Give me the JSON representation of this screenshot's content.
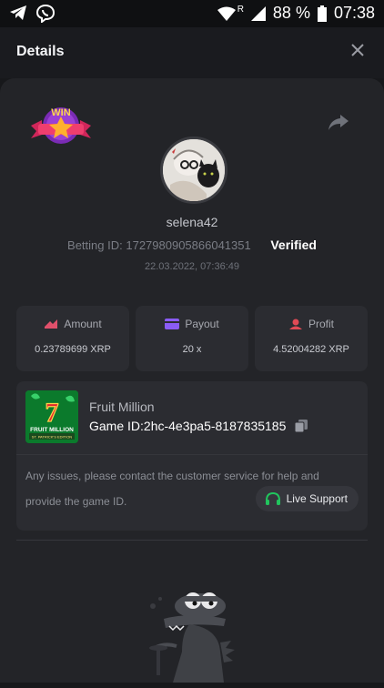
{
  "status_bar": {
    "battery": "88 %",
    "signal_letter": "R",
    "time": "07:38"
  },
  "header": {
    "title": "Details"
  },
  "win_badge": {
    "text": "WIN"
  },
  "user": {
    "name": "selena42",
    "betting_id_label": "Betting ID:",
    "betting_id": "1727980905866041351",
    "verified": "Verified",
    "datetime": "22.03.2022, 07:36:49"
  },
  "stats": [
    {
      "label": "Amount",
      "value": "0.23789699 XRP",
      "color": "#e0506b"
    },
    {
      "label": "Payout",
      "value": "20 x",
      "color": "#8a5cf6"
    },
    {
      "label": "Profit",
      "value": "4.52004282 XRP",
      "color": "#e04a55"
    }
  ],
  "game": {
    "name": "Fruit Million",
    "id_label": "Game ID:",
    "id": "2hc-4e3pa5-8187835185",
    "thumb_title": "FRUIT MILLION",
    "thumb_subtitle": "ST. PATRICK'S EDITION"
  },
  "support": {
    "message": "Any issues, please contact the customer service for help and provide the game ID.",
    "button": "Live Support",
    "accent": "#21c45d"
  }
}
